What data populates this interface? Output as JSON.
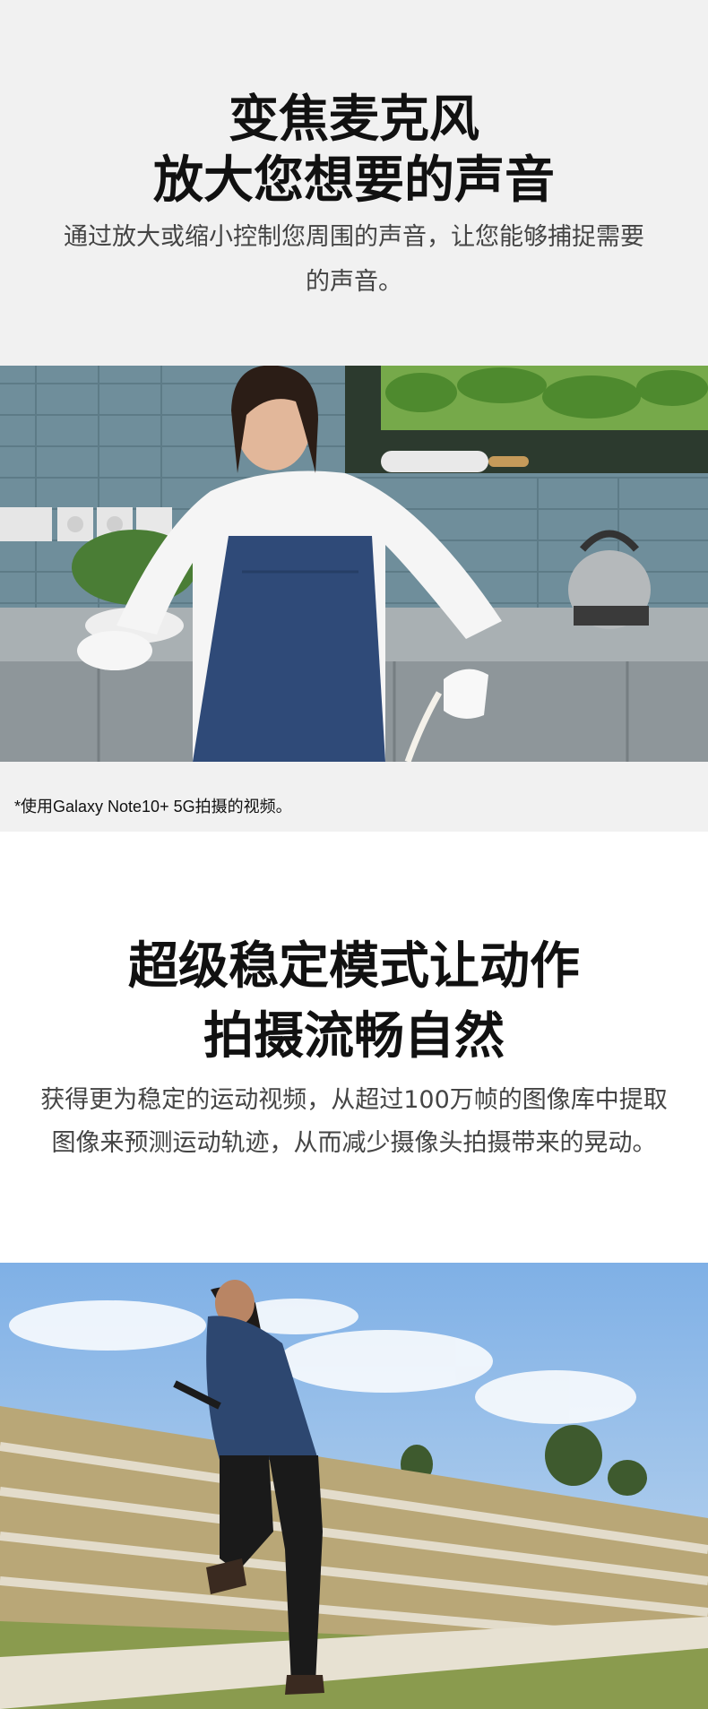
{
  "zoom_section": {
    "title_line1": "变焦麦克风",
    "title_line2": "放大您想要的声音",
    "description": "通过放大或缩小控制您周围的声音，让您能够捕捉需要的声音。",
    "video_caption": "*使用Galaxy Note10+ 5G拍摄的视频。",
    "image_subject": "woman-in-apron-pouring-in-kitchen",
    "background_color": "#f1f1f1"
  },
  "steady_section": {
    "title_line1": "超级稳定模式让动作",
    "title_line2": "拍摄流畅自然",
    "description": "获得更为稳定的运动视频，从超过100万帧的图像库中提取图像来预测运动轨迹，从而减少摄像头拍摄带来的晃动。",
    "image_subject": "man-climbing-outdoor-steps-with-gimbal",
    "background_color": "#ffffff"
  }
}
